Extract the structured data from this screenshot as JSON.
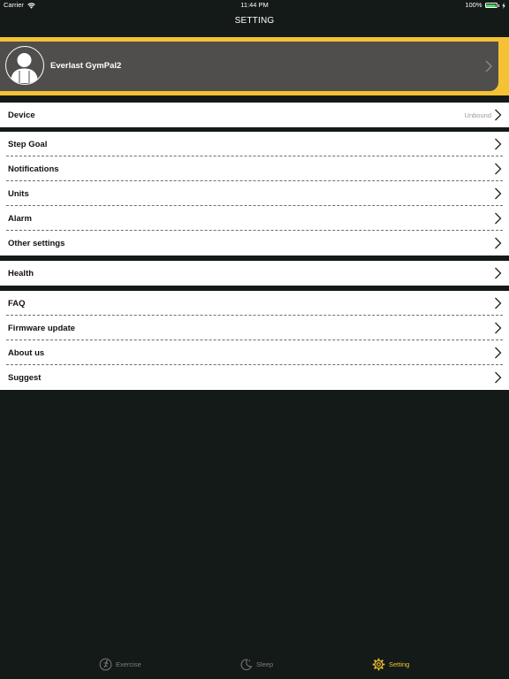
{
  "status_bar": {
    "carrier": "Carrier",
    "time": "11:44 PM",
    "battery": "100%"
  },
  "nav": {
    "title": "SETTING"
  },
  "profile": {
    "name": "Everlast GymPal2"
  },
  "groups": [
    {
      "rows": [
        {
          "label": "Device",
          "value": "Unbound"
        }
      ]
    },
    {
      "rows": [
        {
          "label": "Step Goal"
        },
        {
          "label": "Notifications"
        },
        {
          "label": "Units"
        },
        {
          "label": "Alarm"
        },
        {
          "label": "Other settings"
        }
      ]
    },
    {
      "rows": [
        {
          "label": "Health"
        }
      ]
    },
    {
      "rows": [
        {
          "label": "FAQ"
        },
        {
          "label": "Firmware update"
        },
        {
          "label": "About us"
        },
        {
          "label": "Suggest"
        }
      ]
    }
  ],
  "tabs": [
    {
      "label": "Exercise",
      "icon": "runner-icon"
    },
    {
      "label": "Sleep",
      "icon": "moon-icon"
    },
    {
      "label": "Setting",
      "icon": "gear-icon"
    }
  ],
  "colors": {
    "accent": "#f4c233",
    "background": "#141a17",
    "card": "#4f4e4c",
    "battery": "#4cd964"
  }
}
